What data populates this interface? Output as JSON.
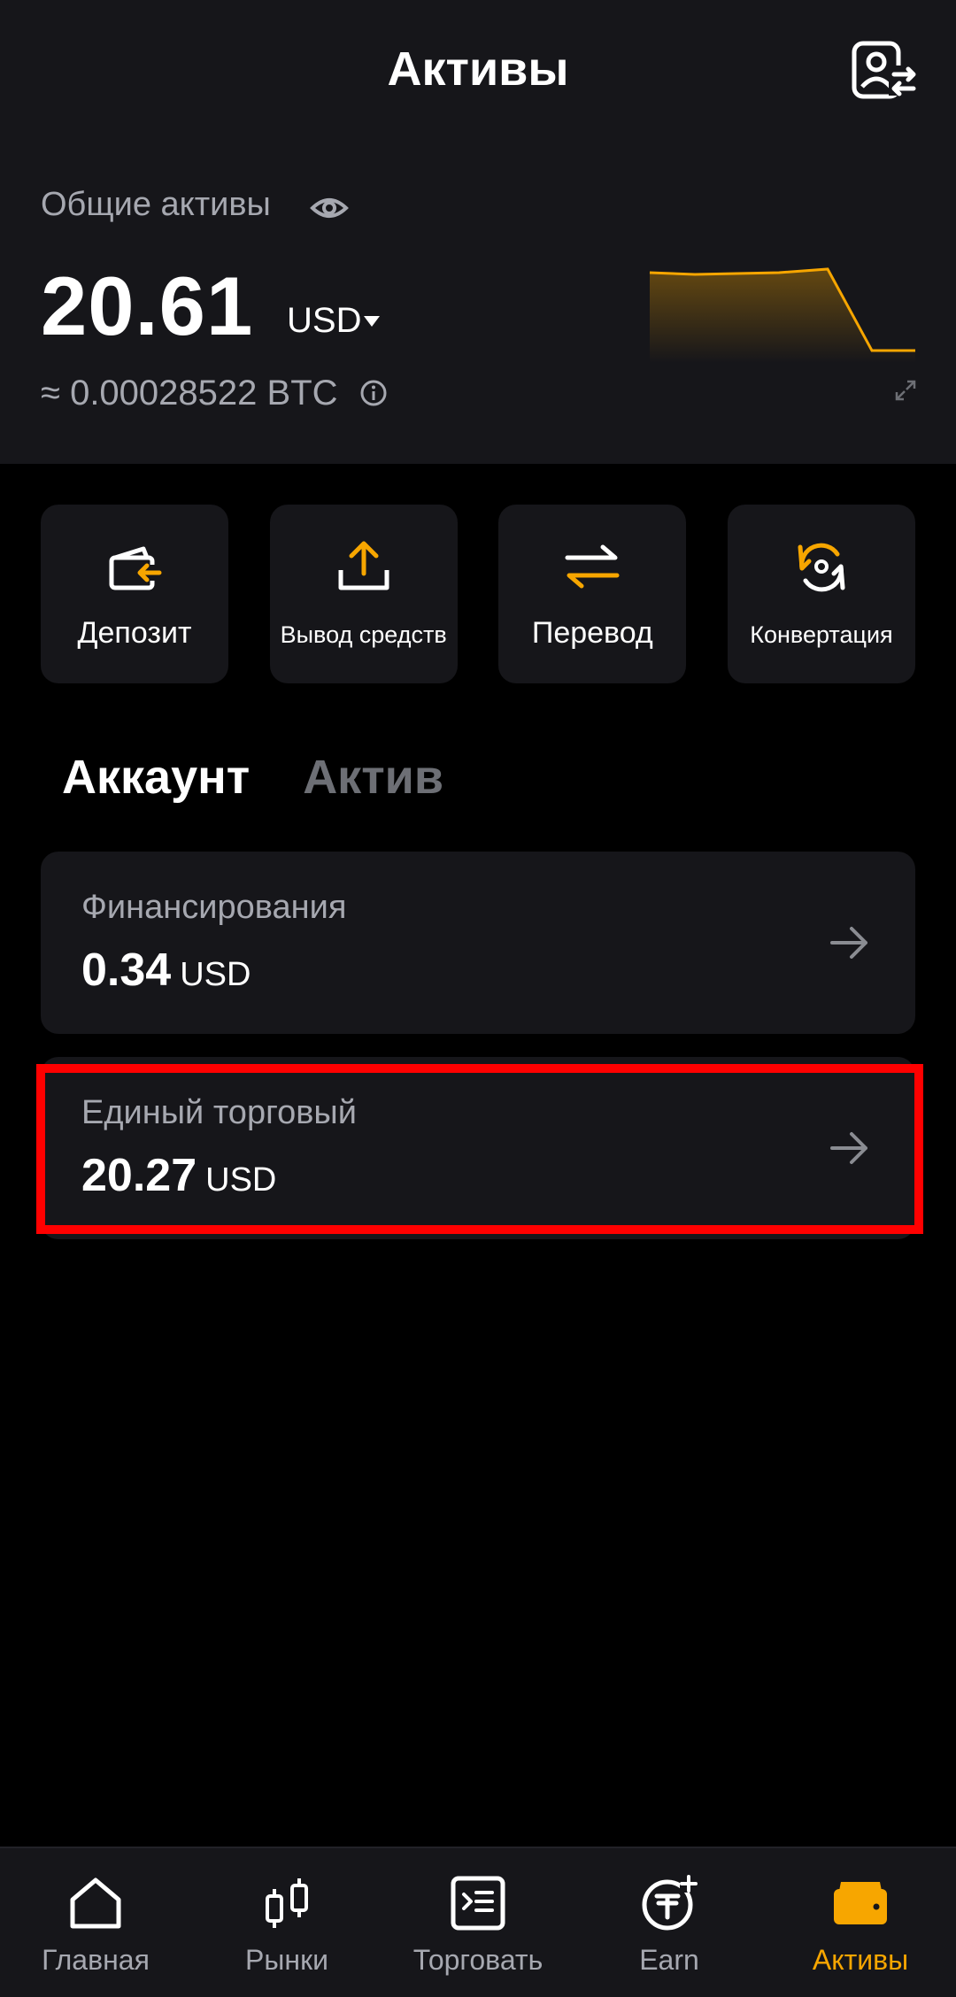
{
  "header": {
    "title": "Активы"
  },
  "summary": {
    "total_label": "Общие активы",
    "total_value": "20.61",
    "currency": "USD",
    "btc_equiv": "≈ 0.00028522 BTC"
  },
  "actions": [
    {
      "label": "Депозит",
      "icon": "deposit-icon"
    },
    {
      "label": "Вывод средств",
      "icon": "withdraw-icon"
    },
    {
      "label": "Перевод",
      "icon": "transfer-icon"
    },
    {
      "label": "Конвертация",
      "icon": "convert-icon"
    }
  ],
  "tabs": [
    {
      "label": "Аккаунт",
      "active": true
    },
    {
      "label": "Актив",
      "active": false
    }
  ],
  "accounts": [
    {
      "name": "Финансирования",
      "amount": "0.34",
      "unit": "USD"
    },
    {
      "name": "Единый торговый",
      "amount": "20.27",
      "unit": "USD"
    }
  ],
  "nav": [
    {
      "label": "Главная",
      "icon": "home-icon",
      "active": false
    },
    {
      "label": "Рынки",
      "icon": "candlestick-icon",
      "active": false
    },
    {
      "label": "Торговать",
      "icon": "trade-icon",
      "active": false
    },
    {
      "label": "Earn",
      "icon": "earn-icon",
      "active": false
    },
    {
      "label": "Активы",
      "icon": "wallet-icon",
      "active": true
    }
  ],
  "colors": {
    "accent": "#f7a600",
    "background": "#000000",
    "surface": "#16161a",
    "muted_text": "#a6a8b0",
    "highlight": "#ff0000"
  }
}
